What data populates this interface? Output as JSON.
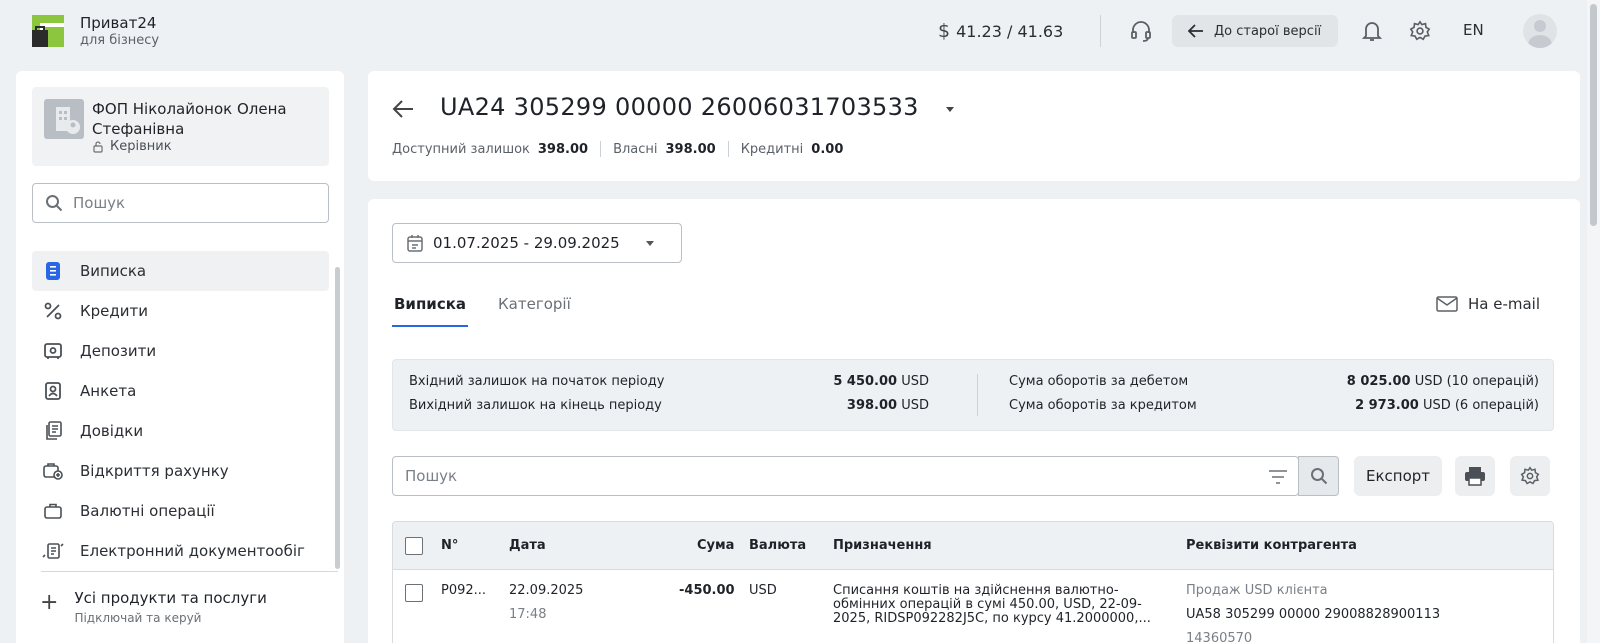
{
  "header": {
    "brand_name": "Приват24",
    "brand_sub": "для бізнесу",
    "rate": "41.23 / 41.63",
    "rate_symbol": "$",
    "old_version_label": "До старої версії",
    "lang": "EN"
  },
  "sidebar": {
    "company_name": "ФОП Ніколайонок Олена Стефанівна",
    "company_role": "Керівник",
    "search_placeholder": "Пошук",
    "items": [
      {
        "label": "Виписка",
        "icon": "statement-icon"
      },
      {
        "label": "Кредити",
        "icon": "percent-icon"
      },
      {
        "label": "Депозити",
        "icon": "safe-icon"
      },
      {
        "label": "Анкета",
        "icon": "profile-icon"
      },
      {
        "label": "Довідки",
        "icon": "documents-icon"
      },
      {
        "label": "Відкриття рахунку",
        "icon": "open-account-icon"
      },
      {
        "label": "Валютні операції",
        "icon": "briefcase-icon"
      },
      {
        "label": "Електронний документообіг",
        "icon": "edoc-icon"
      }
    ],
    "all_products_title": "Усі продукти та послуги",
    "all_products_sub": "Підключай та керуй"
  },
  "account": {
    "number": "UA24 305299 00000 26006031703533",
    "available_label": "Доступний залишок",
    "available_value": "398.00",
    "own_label": "Власні",
    "own_value": "398.00",
    "credit_label": "Кредитні",
    "credit_value": "0.00"
  },
  "statement": {
    "date_range": "01.07.2025 - 29.09.2025",
    "tabs": [
      "Виписка",
      "Категорії"
    ],
    "email_label": "На e-mail",
    "summary": {
      "opening_label": "Вхідний залишок на початок періоду",
      "opening_value": "5 450.00",
      "opening_currency": "USD",
      "closing_label": "Вихідний залишок на кінець періоду",
      "closing_value": "398.00",
      "closing_currency": "USD",
      "debit_label": "Сума оборотів за дебетом",
      "debit_value": "8 025.00",
      "debit_suffix": "USD (10 операцій)",
      "credit_label": "Сума оборотів за кредитом",
      "credit_value": "2 973.00",
      "credit_suffix": "USD (6 операцій)"
    },
    "search_placeholder": "Пошук",
    "export_label": "Експорт",
    "columns": {
      "num": "N°",
      "date": "Дата",
      "amount": "Сума",
      "currency": "Валюта",
      "purpose": "Призначення",
      "counterparty": "Реквізити контрагента"
    },
    "rows": [
      {
        "num": "P092...",
        "date": "22.09.2025",
        "time": "17:48",
        "amount": "-450.00",
        "currency": "USD",
        "purpose": "Списання коштів на здійснення валютно-обмінних операцій в сумі 450.00, USD, 22-09-2025, RIDSP092282J5C, по курсу 41.2000000,...",
        "cp_name": "Продаж USD клієнта",
        "cp_account": "UA58 305299 00000 29008828900113",
        "cp_code": "14360570"
      }
    ]
  }
}
